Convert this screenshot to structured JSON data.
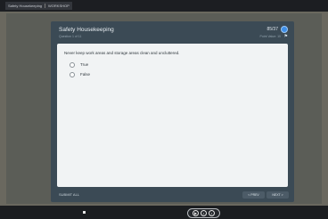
{
  "app_tab": {
    "title": "Safety Housekeeping",
    "subtitle": "WORKSHOP"
  },
  "quiz": {
    "title": "Safety Housekeeping",
    "question_count": "Question 1 of 11",
    "score": "85/37",
    "point_value": "Point Value: 10",
    "point_icon": "flag-icon"
  },
  "question": {
    "text": "Never keep work areas and storage areas clean and uncluttered.",
    "options": [
      {
        "label": "True"
      },
      {
        "label": "False"
      }
    ]
  },
  "footer": {
    "submit_label": "SUBMIT ALL",
    "prev_label": "< PREV",
    "next_label": "NEXT >"
  },
  "colors": {
    "accent": "#3f8fe8",
    "panel": "#3b4a55",
    "card": "#f1f3f4"
  }
}
